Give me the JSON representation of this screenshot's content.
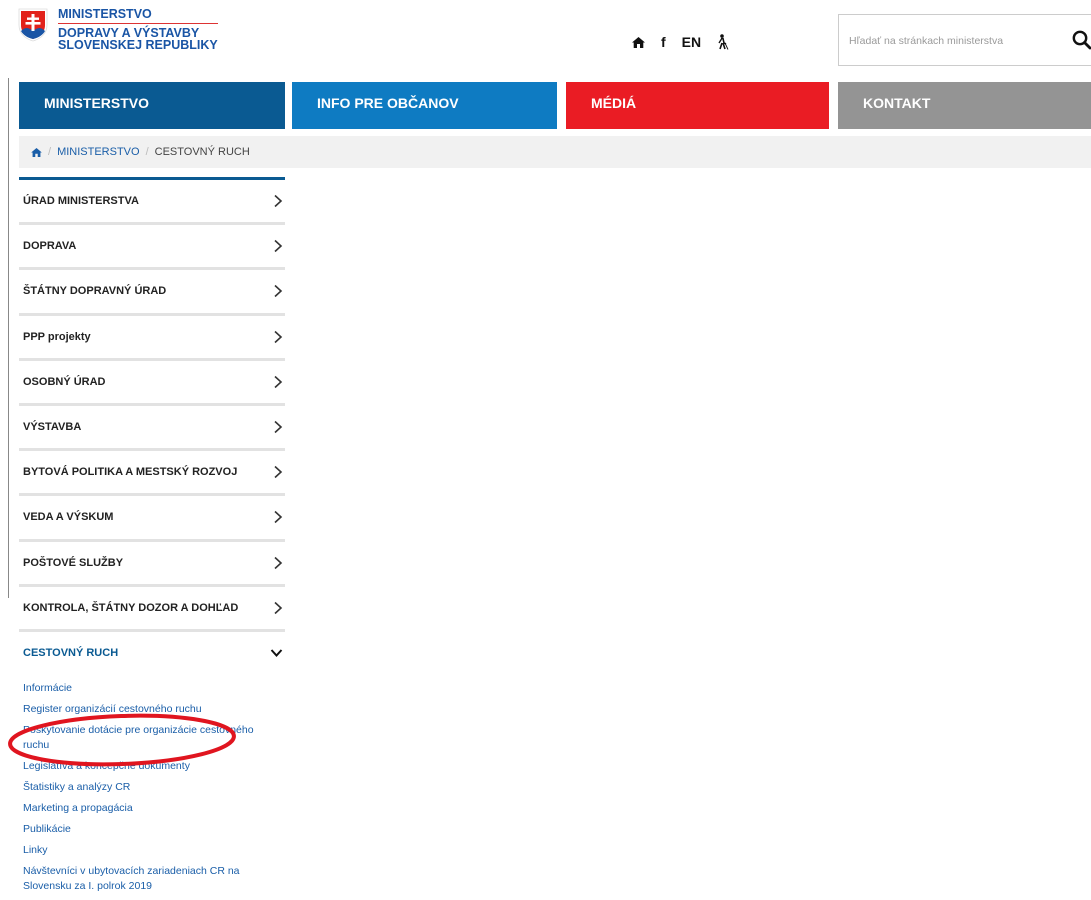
{
  "logo": {
    "line1": "MINISTERSTVO",
    "line2": "DOPRAVY A VÝSTAVBY",
    "line3": "SLOVENSKEJ REPUBLIKY",
    "crest_icon": "slovak-coat-of-arms-icon"
  },
  "utils": {
    "home_icon": "home-icon",
    "facebook_label": "f",
    "lang_label": "EN",
    "accessibility_icon": "blind-person-icon"
  },
  "search": {
    "placeholder": "Hľadať na stránkach ministerstva",
    "icon": "search-icon"
  },
  "nav": {
    "items": [
      {
        "label": "MINISTERSTVO",
        "color": "#0a5a92"
      },
      {
        "label": "INFO PRE OBČANOV",
        "color": "#0e7bc2"
      },
      {
        "label": "MÉDIÁ",
        "color": "#ea1c24"
      },
      {
        "label": "KONTAKT",
        "color": "#949494"
      }
    ]
  },
  "breadcrumb": {
    "home_icon": "home-icon",
    "items": [
      "MINISTERSTVO",
      "CESTOVNÝ RUCH"
    ]
  },
  "sidebar": {
    "items": [
      {
        "label": "ÚRAD MINISTERSTVA"
      },
      {
        "label": "DOPRAVA"
      },
      {
        "label": "ŠTÁTNY DOPRAVNÝ ÚRAD"
      },
      {
        "label": "PPP projekty"
      },
      {
        "label": "OSOBNÝ ÚRAD"
      },
      {
        "label": "VÝSTAVBA"
      },
      {
        "label": "BYTOVÁ POLITIKA A MESTSKÝ ROZVOJ"
      },
      {
        "label": "VEDA A VÝSKUM"
      },
      {
        "label": "POŠTOVÉ SLUŽBY"
      },
      {
        "label": "KONTROLA, ŠTÁTNY DOZOR A DOHĽAD"
      },
      {
        "label": "CESTOVNÝ RUCH"
      }
    ],
    "subitems": [
      "Informácie",
      "Register organizácií cestovného ruchu",
      "Poskytovanie dotácie pre organizácie cestovného ruchu",
      "Legislatíva a koncepčné dokumenty",
      "Štatistiky a analýzy CR",
      "Marketing a propagácia",
      "Publikácie",
      "Linky",
      "Návštevníci v ubytovacích zariadeniach CR na Slovensku za I. polrok 2019"
    ]
  },
  "colors": {
    "accent_blue": "#0a5a92",
    "link_blue": "#1a5ea8",
    "highlight_red": "#e0151f"
  }
}
